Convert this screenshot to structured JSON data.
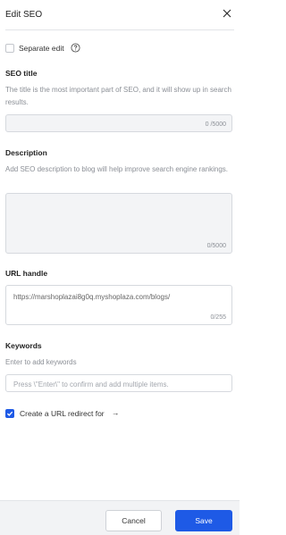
{
  "header": {
    "title": "Edit SEO"
  },
  "separate_edit": {
    "label": "Separate edit",
    "checked": false
  },
  "seo_title": {
    "heading": "SEO title",
    "hint": "The title is the most important part of SEO, and it will show up in search results.",
    "value": "",
    "counter": "0 /5000"
  },
  "description": {
    "heading": "Description",
    "hint": "Add SEO description to blog will help improve search engine rankings.",
    "value": "",
    "counter": "0/5000"
  },
  "url_handle": {
    "heading": "URL handle",
    "value": "https://marshoplazai8g0q.myshoplaza.com/blogs/",
    "counter": "0/255"
  },
  "keywords": {
    "heading": "Keywords",
    "hint": "Enter to add keywords",
    "placeholder": "Press \\\"Enter\\\" to confirm and add multiple items."
  },
  "redirect": {
    "label": "Create a URL redirect for",
    "arrow": "→",
    "checked": true
  },
  "footer": {
    "cancel_label": "Cancel",
    "save_label": "Save"
  },
  "colors": {
    "accent": "#1e5ae6",
    "border": "#d6d9de",
    "muted_text": "#8b8f96"
  },
  "icons": {
    "close": "close-icon",
    "help": "help-circle-icon",
    "check": "check-icon"
  }
}
